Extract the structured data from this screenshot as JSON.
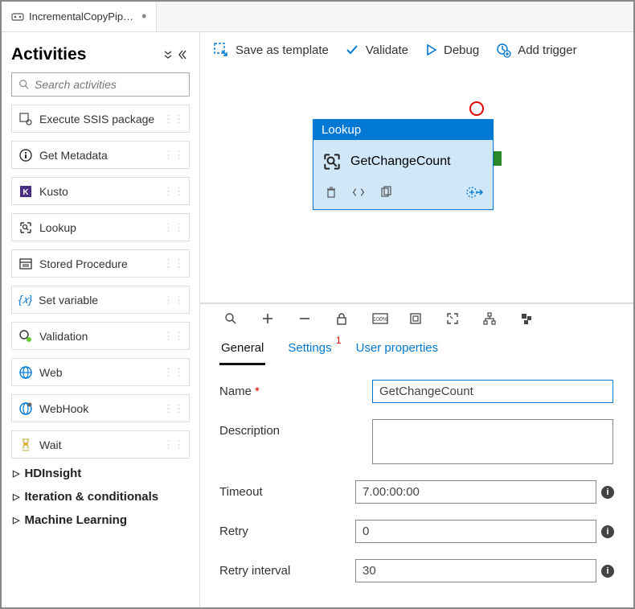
{
  "tab": {
    "title": "IncrementalCopyPip…"
  },
  "sidebar": {
    "title": "Activities",
    "search_placeholder": "Search activities",
    "items": [
      {
        "label": "Execute SSIS package",
        "icon": "ssis-icon"
      },
      {
        "label": "Get Metadata",
        "icon": "metadata-icon"
      },
      {
        "label": "Kusto",
        "icon": "kusto-icon"
      },
      {
        "label": "Lookup",
        "icon": "lookup-icon"
      },
      {
        "label": "Stored Procedure",
        "icon": "stored-proc-icon"
      },
      {
        "label": "Set variable",
        "icon": "set-var-icon"
      },
      {
        "label": "Validation",
        "icon": "validation-icon"
      },
      {
        "label": "Web",
        "icon": "web-icon"
      },
      {
        "label": "WebHook",
        "icon": "webhook-icon"
      },
      {
        "label": "Wait",
        "icon": "wait-icon"
      }
    ],
    "categories": [
      {
        "label": "HDInsight"
      },
      {
        "label": "Iteration & conditionals"
      },
      {
        "label": "Machine Learning"
      }
    ]
  },
  "toolbar": {
    "save_template": "Save as template",
    "validate": "Validate",
    "debug": "Debug",
    "add_trigger": "Add trigger"
  },
  "node": {
    "type": "Lookup",
    "name": "GetChangeCount"
  },
  "editor": {
    "tabs": [
      {
        "label": "General",
        "active": true
      },
      {
        "label": "Settings",
        "active": false,
        "badge": "1"
      },
      {
        "label": "User properties",
        "active": false
      }
    ],
    "form": {
      "name_label": "Name",
      "name_value": "GetChangeCount",
      "desc_label": "Description",
      "desc_value": "",
      "timeout_label": "Timeout",
      "timeout_value": "7.00:00:00",
      "retry_label": "Retry",
      "retry_value": "0",
      "retry_int_label": "Retry interval",
      "retry_int_value": "30"
    }
  }
}
